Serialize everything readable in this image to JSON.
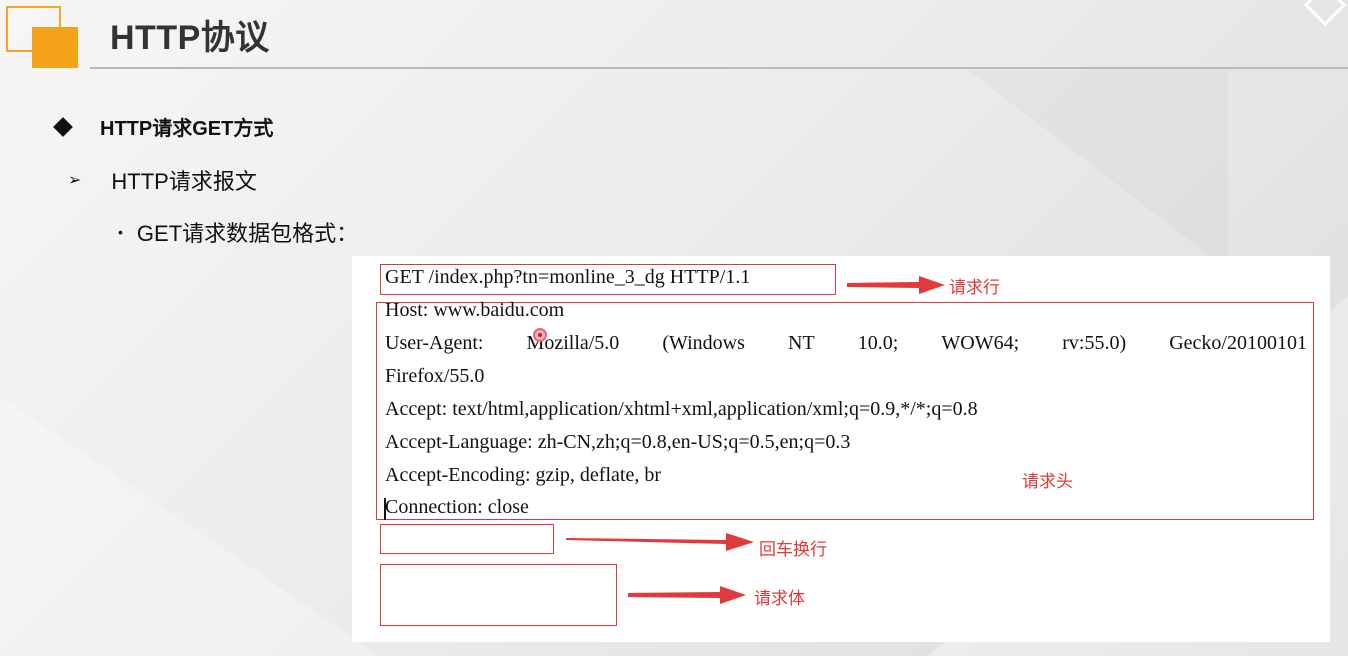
{
  "slide": {
    "title": "HTTP协议",
    "bullets": [
      {
        "marker": "◆",
        "text": "HTTP请求GET方式"
      },
      {
        "marker": "➢",
        "text": "HTTP请求报文"
      },
      {
        "marker": "•",
        "text": "GET请求数据包格式："
      }
    ]
  },
  "request": {
    "request_line": "GET /index.php?tn=monline_3_dg HTTP/1.1",
    "headers": {
      "host": "Host: www.baidu.com",
      "user_agent_parts": [
        "User-Agent:",
        "Mozilla/5.0",
        "(Windows",
        "NT",
        "10.0;",
        "WOW64;",
        "rv:55.0)",
        "Gecko/20100101"
      ],
      "user_agent_cont": "Firefox/55.0",
      "accept": "Accept: text/html,application/xhtml+xml,application/xml;q=0.9,*/*;q=0.8",
      "accept_language": "Accept-Language: zh-CN,zh;q=0.8,en-US;q=0.5,en;q=0.3",
      "accept_encoding": "Accept-Encoding: gzip, deflate, br",
      "connection": "Connection: close"
    }
  },
  "annotations": {
    "request_line": "请求行",
    "headers": "请求头",
    "crlf": "回车换行",
    "body": "请求体"
  },
  "colors": {
    "accent_orange": "#f5a21b",
    "annotation_red": "#e03a3a"
  }
}
